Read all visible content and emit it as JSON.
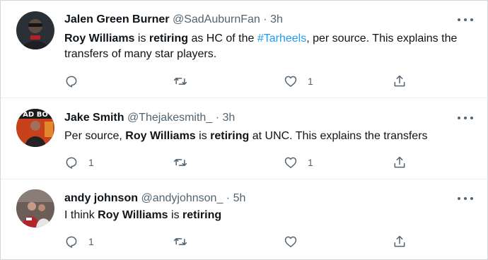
{
  "colors": {
    "accent": "#1d9bf0",
    "muted": "#536471",
    "text": "#0f1419",
    "border": "#e6ecf0"
  },
  "icons": [
    "reply-icon",
    "retweet-icon",
    "like-icon",
    "share-icon",
    "more-icon"
  ],
  "tweets": [
    {
      "name": "Jalen Green Burner",
      "handle": "@SadAuburnFan",
      "separator": "·",
      "time": "3h",
      "body": [
        {
          "text": "Roy Williams",
          "bold": true
        },
        {
          "text": " is "
        },
        {
          "text": "retiring",
          "bold": true
        },
        {
          "text": " as HC of the "
        },
        {
          "text": "#Tarheels",
          "link": true
        },
        {
          "text": ", per source. This explains the transfers of many star players."
        }
      ],
      "reply_count": "",
      "retweet_count": "",
      "like_count": "1"
    },
    {
      "name": "Jake Smith",
      "handle": "@Thejakesmith_",
      "separator": "·",
      "time": "3h",
      "body": [
        {
          "text": "Per source, "
        },
        {
          "text": "Roy Williams",
          "bold": true
        },
        {
          "text": " is "
        },
        {
          "text": "retiring",
          "bold": true
        },
        {
          "text": " at UNC.  This explains the transfers"
        }
      ],
      "reply_count": "1",
      "retweet_count": "",
      "like_count": "1"
    },
    {
      "name": "andy johnson",
      "handle": "@andyjohnson_",
      "separator": "·",
      "time": "5h",
      "body": [
        {
          "text": "I think "
        },
        {
          "text": "Roy Williams",
          "bold": true
        },
        {
          "text": " is "
        },
        {
          "text": "retiring",
          "bold": true
        }
      ],
      "reply_count": "1",
      "retweet_count": "",
      "like_count": ""
    }
  ]
}
